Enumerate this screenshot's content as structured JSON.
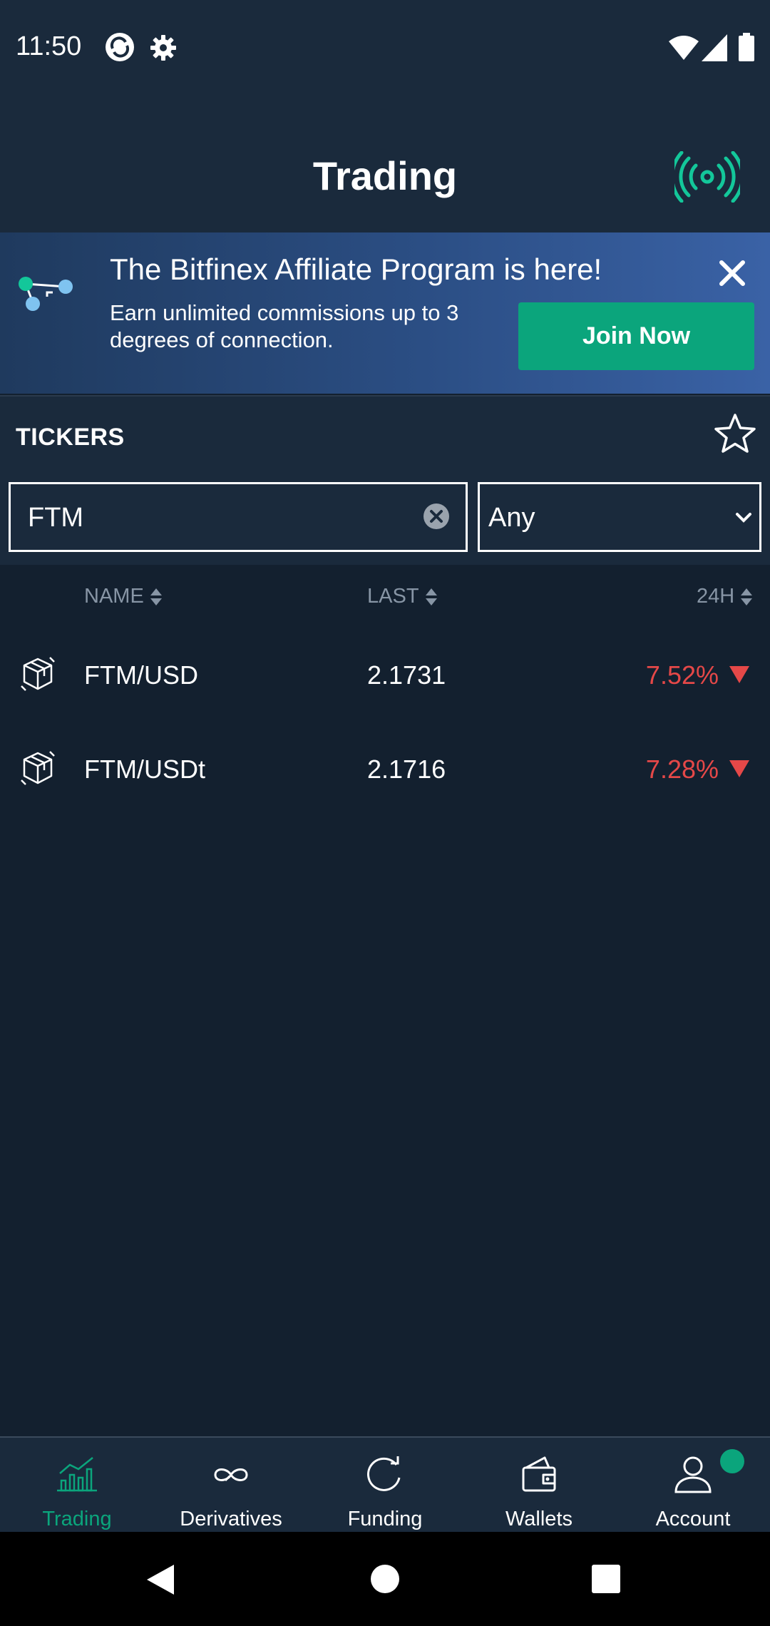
{
  "status_bar": {
    "time": "11:50"
  },
  "header": {
    "title": "Trading"
  },
  "banner": {
    "title": "The Bitfinex Affiliate Program is here!",
    "subtitle": "Earn unlimited commissions up to 3 degrees of connection.",
    "cta_label": "Join Now"
  },
  "tickers": {
    "section_title": "TICKERS",
    "search_value": "FTM",
    "filter_value": "Any",
    "columns": {
      "name": "NAME",
      "last": "LAST",
      "change": "24H"
    },
    "rows": [
      {
        "pair": "FTM/USD",
        "last": "2.1731",
        "change": "7.52%",
        "direction": "down"
      },
      {
        "pair": "FTM/USDt",
        "last": "2.1716",
        "change": "7.28%",
        "direction": "down"
      }
    ]
  },
  "tab_bar": {
    "items": [
      {
        "label": "Trading",
        "icon": "chart-icon",
        "active": true
      },
      {
        "label": "Derivatives",
        "icon": "infinity-icon",
        "active": false
      },
      {
        "label": "Funding",
        "icon": "refresh-icon",
        "active": false
      },
      {
        "label": "Wallets",
        "icon": "wallet-icon",
        "active": false
      },
      {
        "label": "Account",
        "icon": "user-icon",
        "active": false
      }
    ]
  },
  "colors": {
    "accent": "#0ba57c",
    "negative": "#e54848",
    "background": "#13202f",
    "surface": "#1a2a3c"
  }
}
